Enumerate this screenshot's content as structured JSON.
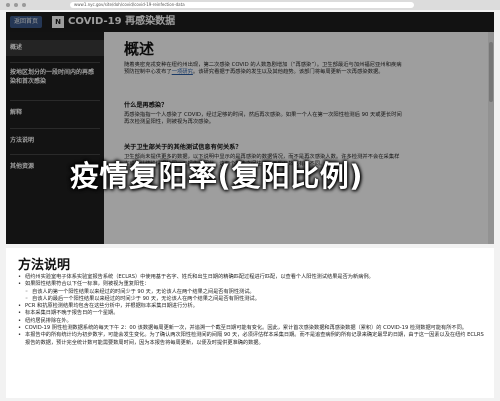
{
  "browser": {
    "url": "www1.nyc.gov/site/doh/covid/covid-19-reinfection-data"
  },
  "header": {
    "back_label": "返回首页",
    "title": "COVID-19 再感染数据"
  },
  "sidebar": {
    "items": [
      {
        "label": "概述"
      },
      {
        "label": "按地区划分的一段时间内的再感染和首次感染"
      },
      {
        "label": "解释"
      },
      {
        "label": "方法说明"
      },
      {
        "label": "其他资源"
      }
    ]
  },
  "overview": {
    "title": "概述",
    "intro_prefix": "随着奥密克戎变种在纽约州出现，第二次感染 COVID 的人数急剧增加（“再感染”）。卫生部最近与加州福尼亚州和疾病预防控制中心发布了",
    "intro_link": "一项研究",
    "intro_suffix": "。该研究看据于再感染的发生以及其他趋势。该部门将每周更新一次再感染数据。",
    "what_heading": "什么是再感染？",
    "what_text": "再感染指指一个人感染了 COVID，经过足够的时间，然后再次感染。如果一个人在第一次阳性检测后 90 天或更长时间再次检测呈阳性，则被视为再次感染。",
    "more_heading": "关于卫生部关于的其他测试信息有何关系？",
    "more_text": "卫生部尚未提供更多的数据，以下说明中显示的是再感染的数据情况，而不是再次感染人数。许多检测并不会在采集样本或确认结论情况的同一天报告。因此，这两个报告之间往往一天的日数据有所不同。"
  },
  "headline": {
    "text": "疫情复阳率(复阳比例)"
  },
  "methods": {
    "title": "方法说明",
    "items": [
      {
        "text": "纽约州实验室电子体系实验室报告系统（ECLRS）中使用基于名字、姓氏和出生日期的精确匹配过程进行匹配，以查看个人阳性测试结果是否为新病例。",
        "indent": false
      },
      {
        "text": "如果阳性结果符合以下任一标准，则被视为重复阳性：",
        "indent": false
      },
      {
        "text": "自该人的第一个阳性结果以来经过的时间少于 90 天，无论该人在两个结果之间是否有阴性测试。",
        "indent": true
      },
      {
        "text": "自该人的最后一个阳性结果以来经过的时间少于 90 天，无论该人在两个结果之间是否有阴性测试。",
        "indent": true
      },
      {
        "text": "PCR 和抗原检测结果均包含在这些分析中，并根据标本采集日期进行分析。",
        "indent": false
      },
      {
        "text": "标本采集日期不晚于报告日的一个星期。",
        "indent": false
      },
      {
        "text": "纽约居民排除在外。",
        "indent": false
      },
      {
        "text": "COVID-19 阴性检测数据系统的每天下午 2：00 该数据每周更新一次，并追溯一个截至日期可能有变化。因此，累计首次感染数据和再感染数据（累积）的 COVID-19 检测数据可能有所不同。",
        "indent": false
      },
      {
        "text": "本报告中的所有统计均为初步数字，可能会发生变化。为了确认两次阳性检测间的间隔 90 天，必须评估样本采集日期。而不是追查病例的所有记录来确定最早的日期，由于这一因素以及在纽约 ECLRS 报告的数据，预计完全统计数可能需要数周时间，因为本报告将每周更新，以便及时提供更准确的数据。",
        "indent": false
      }
    ]
  }
}
